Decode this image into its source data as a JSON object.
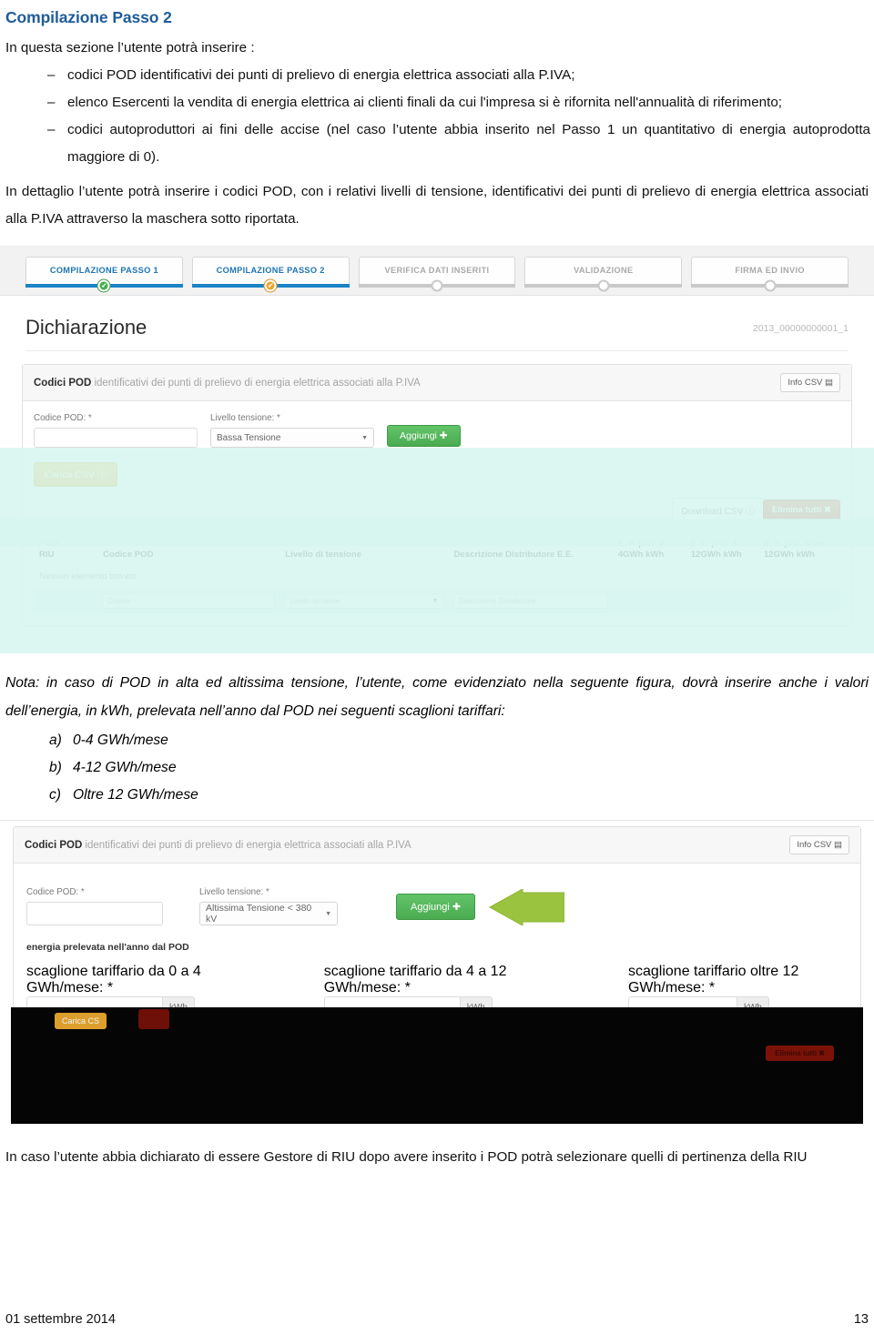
{
  "document": {
    "heading": "Compilazione Passo 2",
    "intro": "In questa sezione l’utente potrà inserire :",
    "bullets": [
      "codici POD identificativi dei punti di prelievo di energia elettrica associati alla P.IVA;",
      "elenco Esercenti la vendita di energia elettrica ai clienti finali da cui l'impresa si è rifornita nell'annualità di riferimento;",
      "codici autoproduttori ai fini delle accise (nel caso l’utente abbia inserito nel Passo 1 un quantitativo di energia autoprodotta maggiore di 0)."
    ],
    "bullet_mark": "–",
    "detail_paragraph": "In dettaglio l’utente potrà inserire i codici POD, con i relativi livelli di tensione, identificativi dei punti di prelievo di energia elettrica associati alla P.IVA  attraverso la maschera sotto riportata.",
    "note_paragraph": "Nota: in caso di POD in alta ed altissima tensione, l’utente, come evidenziato nella seguente figura, dovrà inserire anche i valori dell’energia, in kWh, prelevata nell’anno dal POD nei seguenti scaglioni tariffari:",
    "scaglioni": [
      {
        "mark": "a)",
        "text": "0-4 GWh/mese"
      },
      {
        "mark": "b)",
        "text": "4-12 GWh/mese"
      },
      {
        "mark": "c)",
        "text": "Oltre 12 GWh/mese"
      }
    ],
    "closing_paragraph": "In caso l’utente abbia dichiarato di essere Gestore di RIU dopo avere inserito i POD potrà selezionare quelli di pertinenza della RIU"
  },
  "footer": {
    "date": "01 settembre 2014",
    "page_number": "13"
  },
  "screenshot1": {
    "wizard": {
      "steps": [
        {
          "label": "COMPILAZIONE PASSO 1",
          "state": "done"
        },
        {
          "label": "COMPILAZIONE PASSO 2",
          "state": "current"
        },
        {
          "label": "VERIFICA DATI INSERITI",
          "state": "pending"
        },
        {
          "label": "VALIDAZIONE",
          "state": "pending"
        },
        {
          "label": "FIRMA ED INVIO",
          "state": "pending"
        }
      ],
      "done_glyph": "✔",
      "current_glyph": "✔"
    },
    "declaration": {
      "title": "Dichiarazione",
      "id": "2013_00000000001_1"
    },
    "panel": {
      "title_bold": "Codici POD",
      "title_sub": " identificativi dei punti di prelievo di energia elettrica associati alla P.IVA",
      "info_csv_label": "Info CSV",
      "info_csv_icon": "▤"
    },
    "form": {
      "codice_pod_label": "Codice POD: *",
      "codice_pod_value": "",
      "livello_tensione_label": "Livello tensione: *",
      "livello_tensione_value": "Bassa Tensione",
      "aggiungi_label": "Aggiungi ✚",
      "carica_csv_label": "Carica CSV ⓘ"
    },
    "table_actions": {
      "download_csv_label": "Download CSV ⓘ",
      "elimina_tutti_label": "Elimina tutti ✖"
    },
    "table": {
      "headers": [
        "POD\nRIU",
        "Codice POD",
        "Livello di tensione",
        "Descrizione Distributore E.E.",
        "E. e. prel. 0-\n4GWh kWh",
        "E. e. prel. 4-\n12GWh kWh",
        "E. e. prel. oltre\n12GWh kWh"
      ],
      "headers_split": [
        [
          "POD",
          "RIU"
        ],
        [
          "",
          "Codice POD"
        ],
        [
          "",
          "Livello di tensione"
        ],
        [
          "",
          "Descrizione Distributore E.E."
        ],
        [
          "E. e. prel. 0-",
          "4GWh kWh"
        ],
        [
          "E. e. prel. 4-",
          "12GWh kWh"
        ],
        [
          "E. e. prel. oltre",
          "12GWh kWh"
        ]
      ],
      "empty_message": "Nessun elemento trovato",
      "row_inputs": {
        "codice_placeholder": "Codice",
        "livello_placeholder": "Livello tensione",
        "distributore_placeholder": "Descrizione Distributore"
      }
    }
  },
  "screenshot2": {
    "panel": {
      "title_bold": "Codici POD",
      "title_sub": " identificativi dei punti di prelievo di energia elettrica associati alla P.IVA",
      "info_csv_label": "Info CSV",
      "info_csv_icon": "▤"
    },
    "form": {
      "codice_pod_label": "Codice POD: *",
      "codice_pod_value": "",
      "livello_tensione_label": "Livello tensione: *",
      "livello_tensione_value": "Altissima Tensione < 380 kV",
      "aggiungi_label": "Aggiungi ✚"
    },
    "energia": {
      "section_label": "energia prelevata nell'anno dal POD",
      "fields": [
        {
          "label": "scaglione tariffario da 0 a 4 GWh/mese: *",
          "value": "",
          "unit": "kWh"
        },
        {
          "label": "scaglione tariffario da 4 a 12 GWh/mese: *",
          "value": "",
          "unit": "kWh"
        },
        {
          "label": "scaglione tariffario oltre 12 GWh/mese: *",
          "value": "",
          "unit": "kWh"
        }
      ]
    },
    "carica_csv_label": "Carica CS",
    "elimina_tutti_label": "Elimina tutti ✖"
  },
  "colors": {
    "heading_blue": "#1f5c99",
    "step_active_blue": "#1b83c7",
    "step_done_green": "#42b04a",
    "step_current_orange": "#f0a32c",
    "button_green": "#4aab51",
    "button_yellow": "#efab2e",
    "button_red": "#cf4a33",
    "highlight_cyan": "#d6f6f0",
    "arrow_green": "#9ac43f"
  }
}
